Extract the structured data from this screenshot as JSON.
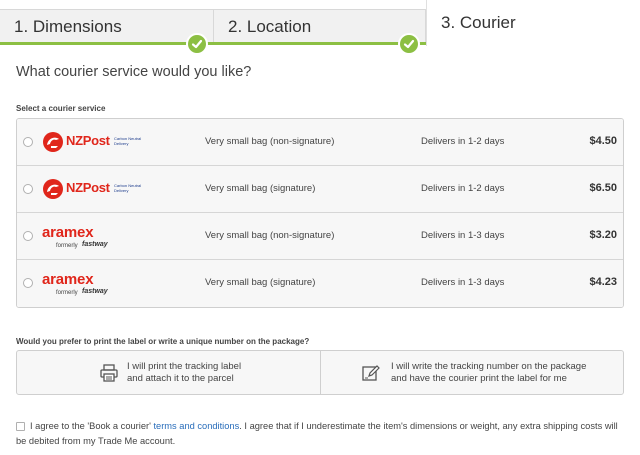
{
  "tabs": [
    {
      "label": "1. Dimensions",
      "state": "complete"
    },
    {
      "label": "2. Location",
      "state": "complete"
    },
    {
      "label": "3. Courier",
      "state": "active"
    }
  ],
  "colors": {
    "accent_green": "#8cbf43",
    "brand_red": "#e0261b",
    "link_blue": "#2a6ebb"
  },
  "question": "What courier service would you like?",
  "courier_section_label": "Select a courier service",
  "couriers": [
    {
      "brand": "NZPost",
      "tag": "Carbon Neutral Delivery",
      "service": "Very small bag (non-signature)",
      "delivery": "Delivers in 1-2 days",
      "price": "$4.50",
      "logo_icon": "nzpost-logo-icon"
    },
    {
      "brand": "NZPost",
      "tag": "Carbon Neutral Delivery",
      "service": "Very small bag (signature)",
      "delivery": "Delivers in 1-2 days",
      "price": "$6.50",
      "logo_icon": "nzpost-logo-icon"
    },
    {
      "brand": "aramex",
      "formerly": "formerly",
      "former_brand": "fastway",
      "service": "Very small bag (non-signature)",
      "delivery": "Delivers in 1-3 days",
      "price": "$3.20",
      "logo_icon": "aramex-logo-icon"
    },
    {
      "brand": "aramex",
      "formerly": "formerly",
      "former_brand": "fastway",
      "service": "Very small bag (signature)",
      "delivery": "Delivers in 1-3 days",
      "price": "$4.23",
      "logo_icon": "aramex-logo-icon"
    }
  ],
  "label_question": "Would you prefer to print the label or write a unique number on the package?",
  "label_options": [
    {
      "icon": "printer-icon",
      "line1": "I will print the tracking label",
      "line2": "and attach it to the parcel"
    },
    {
      "icon": "pencil-icon",
      "line1": "I will write the tracking number on the package",
      "line2": "and have the courier print the label for me"
    }
  ],
  "agreement": {
    "before": "I agree to the 'Book a courier' ",
    "link": "terms and conditions",
    "after": ". I agree that if I underestimate the item's dimensions or weight, any extra shipping costs will be debited from my Trade Me account."
  }
}
